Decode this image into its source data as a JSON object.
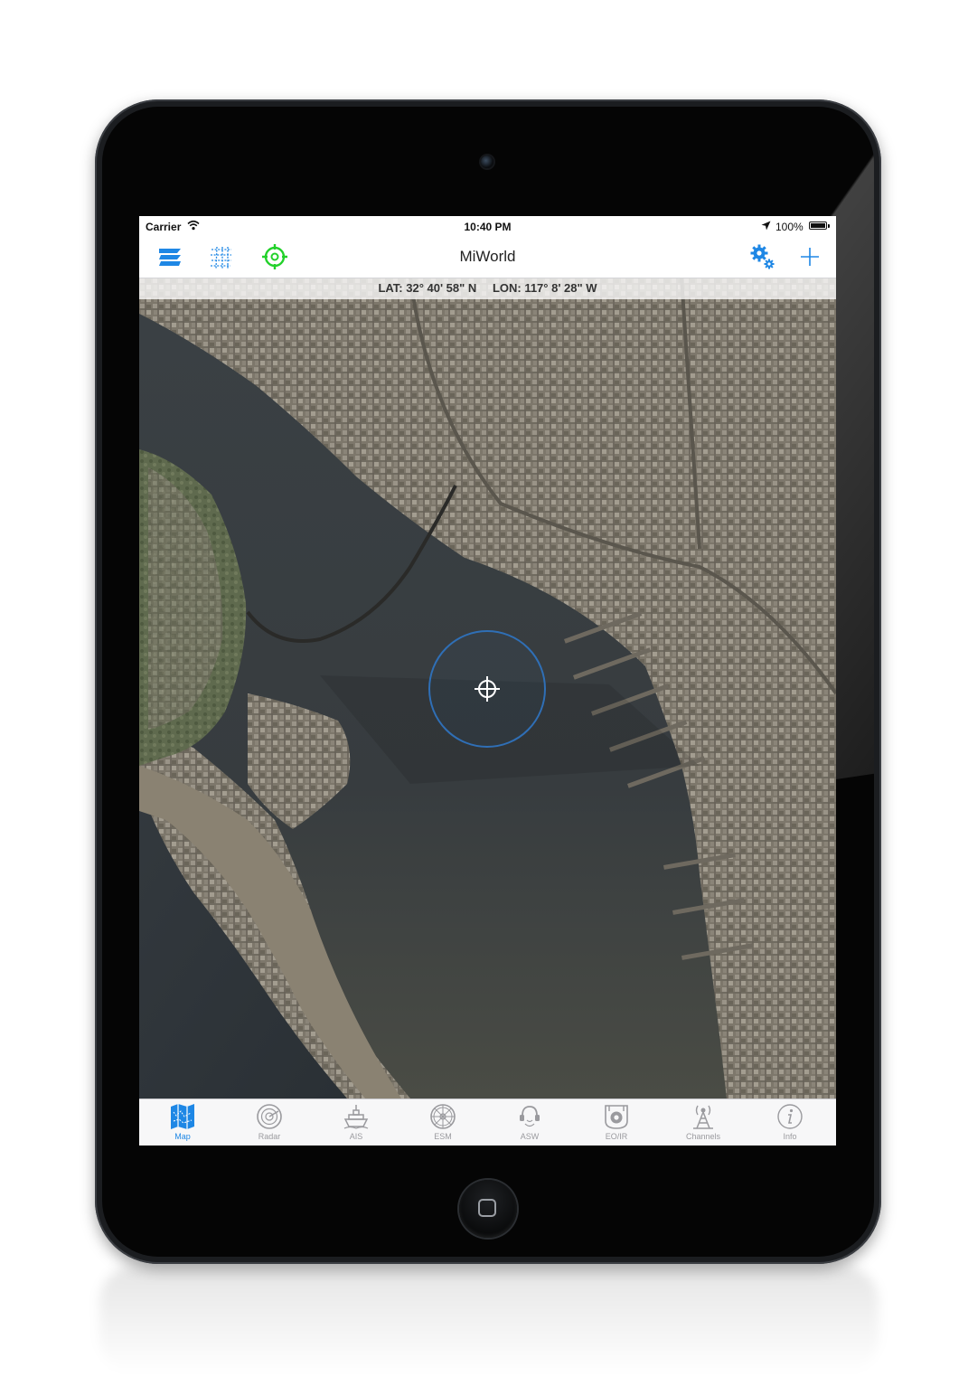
{
  "status_bar": {
    "carrier": "Carrier",
    "time": "10:40 PM",
    "battery": "100%"
  },
  "nav_bar": {
    "title": "MiWorld",
    "left_icons": [
      "layers-icon",
      "grid-overlay-icon",
      "target-icon"
    ],
    "right_icons": [
      "settings-gears-icon",
      "add-icon"
    ]
  },
  "map": {
    "lat_label": "LAT: 32° 40' 58\" N",
    "lon_label": "LON: 117° 8' 28\" W"
  },
  "tabs": [
    {
      "label": "Map",
      "icon": "map-icon",
      "active": true
    },
    {
      "label": "Radar",
      "icon": "radar-icon",
      "active": false
    },
    {
      "label": "AIS",
      "icon": "ship-icon",
      "active": false
    },
    {
      "label": "ESM",
      "icon": "esm-wheel-icon",
      "active": false
    },
    {
      "label": "ASW",
      "icon": "sonar-icon",
      "active": false
    },
    {
      "label": "EO/IR",
      "icon": "camera-icon",
      "active": false
    },
    {
      "label": "Channels",
      "icon": "antenna-tower-icon",
      "active": false
    },
    {
      "label": "Info",
      "icon": "info-icon",
      "active": false
    }
  ],
  "colors": {
    "accent": "#1e87e5",
    "target_green": "#22d12a",
    "water": "#3d4347",
    "land": "#7b7466"
  }
}
